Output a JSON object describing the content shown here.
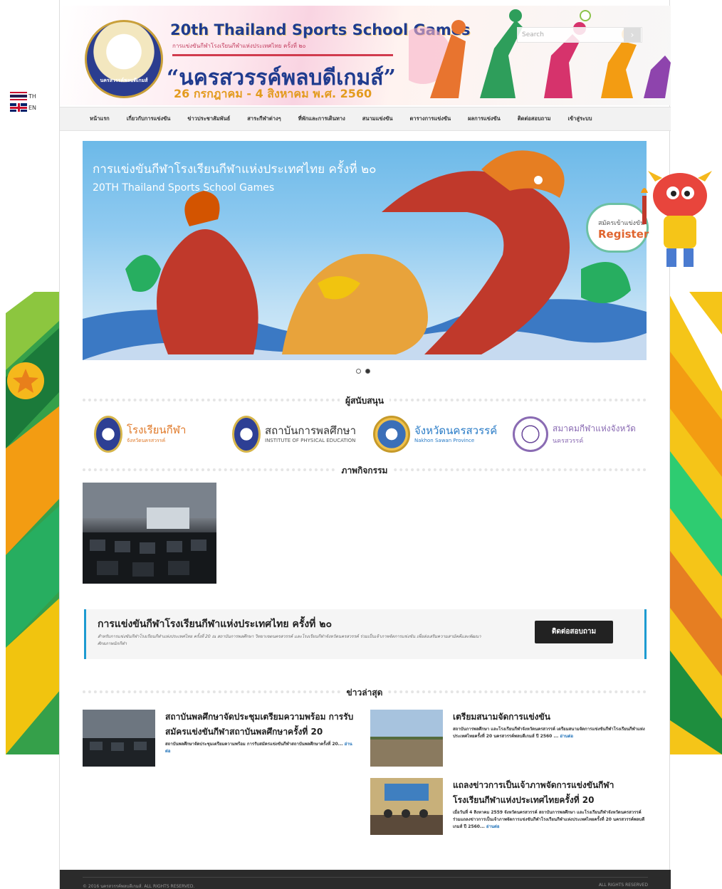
{
  "language": {
    "th_label": "TH",
    "en_label": "EN"
  },
  "header": {
    "title": "20th Thailand Sports School Games",
    "subtitle": "การแข่งขันกีฬาโรงเรียนกีฬาแห่งประเทศไทย ครั้งที่ ๒๐",
    "slogan": "“นครสวรรค์พลบดีเกมส์”",
    "dates": "26 กรกฎาคม - 4 สิงหาคม พ.ศ. 2560",
    "logo_text": "นครสวรรค์พลบดีเกมส์",
    "search_placeholder": "Search"
  },
  "nav": {
    "items": [
      {
        "label": "หน้าแรก"
      },
      {
        "label": "เกี่ยวกับการแข่งขัน"
      },
      {
        "label": "ข่าวประชาสัมพันธ์"
      },
      {
        "label": "สาระกีฬาต่างๆ"
      },
      {
        "label": "ที่พักและการเดินทาง"
      },
      {
        "label": "สนามแข่งขัน"
      },
      {
        "label": "ตารางการแข่งขัน"
      },
      {
        "label": "ผลการแข่งขัน"
      },
      {
        "label": "ติดต่อสอบถาม"
      },
      {
        "label": "เข้าสู่ระบบ"
      }
    ]
  },
  "slider": {
    "title_th": "การแข่งขันกีฬาโรงเรียนกีฬาแห่งประเทศไทย ครั้งที่ ๒๐",
    "title_en": "20TH Thailand Sports School Games",
    "active_index": 2,
    "count": 2
  },
  "register": {
    "top": "สมัครเข้าแข่งขัน",
    "bottom": "Register"
  },
  "sections": {
    "sponsors": "ผู้สนับสนุน",
    "activities": "ภาพกิจกรรม",
    "news": "ข่าวล่าสุด"
  },
  "sponsors": [
    {
      "name": "โรงเรียนกีฬา",
      "sub": "จังหวัดนครสวรรค์",
      "color": "#e07a2a"
    },
    {
      "name": "สถาบันการพลศึกษา",
      "sub": "INSTITUTE OF PHYSICAL EDUCATION",
      "color": "#333333"
    },
    {
      "name": "จังหวัดนครสวรรค์",
      "sub": "Nakhon Sawan Province",
      "color": "#2a7cc7"
    },
    {
      "name": "สมาคมกีฬาแห่งจังหวัด",
      "sub": "นครสวรรค์",
      "color": "#8a6bb3"
    }
  ],
  "callout": {
    "title": "การแข่งขันกีฬาโรงเรียนกีฬาแห่งประเทศไทย ครั้งที่ ๒๐",
    "desc": "สำหรับการแข่งขันกีฬาโรงเรียนกีฬาแห่งประเทศไทย ครั้งที่ 20 ณ สถาบันการพลศึกษา วิทยาเขตนครสวรรค์ และโรงเรียนกีฬาจังหวัดนครสวรรค์ ร่วมเป็นเจ้าภาพจัดการแข่งขัน เพื่อส่งเสริมความสามัคคีและพัฒนาศักยภาพนักกีฬา",
    "button": "ติดต่อสอบถาม"
  },
  "news": [
    {
      "title": "สถาบันพลศึกษาจัดประชุมเตรียมความพร้อม การรับสมัครแข่งขันกีฬาสถาบันพลศึกษาครั้งที่ 20",
      "excerpt": "สถาบันพลศึกษาจัดประชุมเตรียมความพร้อม การรับสมัครแข่งขันกีฬาสถาบันพลศึกษาครั้งที่ 20...",
      "more": "อ่านต่อ"
    },
    {
      "title": "เตรียมสนามจัดการแข่งขัน",
      "excerpt": "สถาบันการพลศึกษา และโรงเรียนกีฬาจังหวัดนครสวรรค์ เตรียมสนามจัดการแข่งขันกีฬาโรงเรียนกีฬาแห่งประเทศไทยครั้งที่ 20 นครสวรรค์พลบดีเกมส์ ปี 2560 ...",
      "more": "อ่านต่อ"
    },
    {
      "title": "แถลงข่าวการเป็นเจ้าภาพจัดการแข่งขันกีฬาโรงเรียนกีฬาแห่งประเทศไทยครั้งที่ 20",
      "excerpt": "เมื่อวันที่ 4 สิงหาคม 2559 จังหวัดนครสวรรค์ สถาบันการพลศึกษา และโรงเรียนกีฬาจังหวัดนครสวรรค์ ร่วมแถลงข่าวการเป็นเจ้าภาพจัดการแข่งขันกีฬาโรงเรียนกีฬาแห่งประเทศไทยครั้งที่ 20 นครสวรรค์พลบดีเกมส์ ปี 2560...",
      "more": "อ่านต่อ"
    }
  ],
  "footer": {
    "left": "© 2016 นครสวรรค์พลบดีเกมส์. ALL RIGHTS RESERVED.",
    "right": "ALL RIGHTS RESERVED"
  }
}
